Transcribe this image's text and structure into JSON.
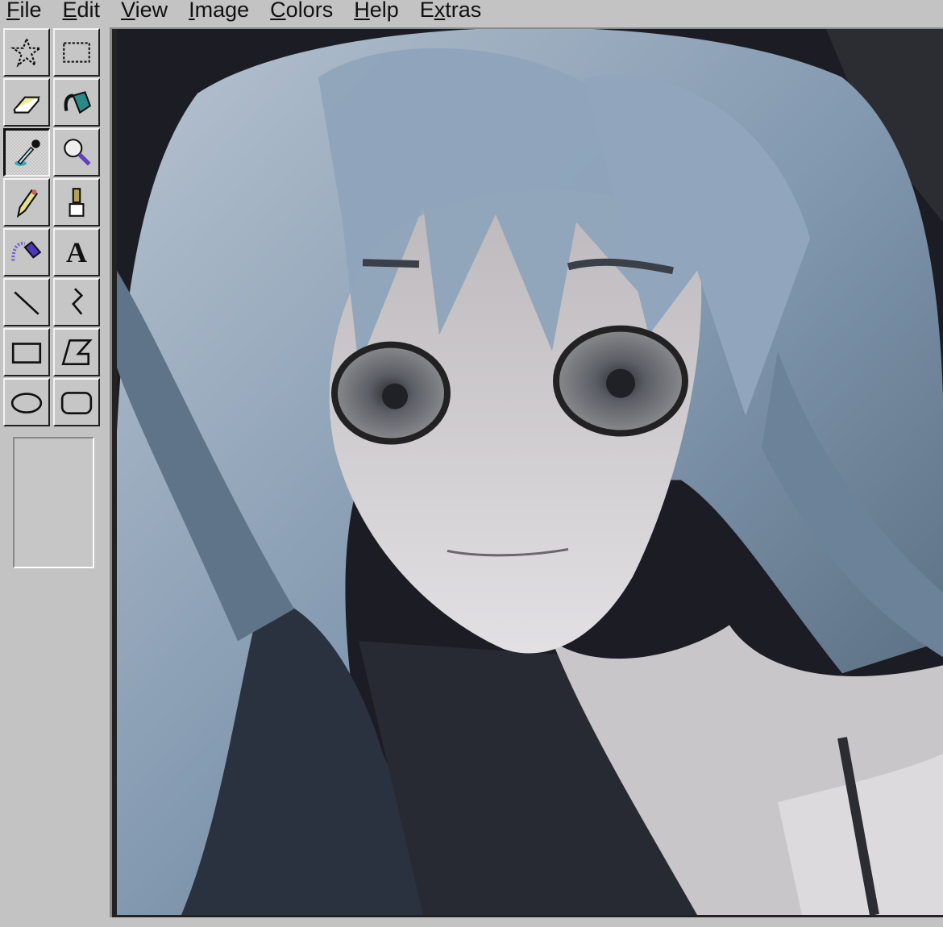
{
  "menu": {
    "items": [
      {
        "label": "File",
        "accel": "F",
        "rest": "ile"
      },
      {
        "label": "Edit",
        "accel": "E",
        "rest": "dit"
      },
      {
        "label": "View",
        "accel": "V",
        "rest": "iew"
      },
      {
        "label": "Image",
        "accel": "I",
        "rest": "mage"
      },
      {
        "label": "Colors",
        "accel": "C",
        "rest": "olors"
      },
      {
        "label": "Help",
        "accel": "H",
        "rest": "elp"
      },
      {
        "label": "Extras",
        "accel": "x",
        "pre": "E",
        "rest": "tras"
      }
    ]
  },
  "tools": [
    {
      "name": "free-form-select",
      "icon": "star-select-icon"
    },
    {
      "name": "rectangle-select",
      "icon": "rect-select-icon"
    },
    {
      "name": "eraser",
      "icon": "eraser-icon"
    },
    {
      "name": "fill",
      "icon": "paint-bucket-icon"
    },
    {
      "name": "pick-color",
      "icon": "eyedropper-icon",
      "active": true
    },
    {
      "name": "magnifier",
      "icon": "magnifier-icon"
    },
    {
      "name": "pencil",
      "icon": "pencil-icon"
    },
    {
      "name": "brush",
      "icon": "brush-icon"
    },
    {
      "name": "airbrush",
      "icon": "airbrush-icon"
    },
    {
      "name": "text",
      "icon": "text-icon",
      "glyph": "A"
    },
    {
      "name": "line",
      "icon": "line-icon"
    },
    {
      "name": "curve",
      "icon": "curve-icon"
    },
    {
      "name": "rectangle",
      "icon": "rectangle-icon"
    },
    {
      "name": "polygon",
      "icon": "polygon-icon"
    },
    {
      "name": "ellipse",
      "icon": "ellipse-icon"
    },
    {
      "name": "rounded-rectangle",
      "icon": "rounded-rectangle-icon"
    }
  ],
  "colors": {
    "chrome": "#c3c3c3",
    "hair": "#8fa3b8",
    "face": "#d6d4d6",
    "background": "#1c1d24"
  }
}
